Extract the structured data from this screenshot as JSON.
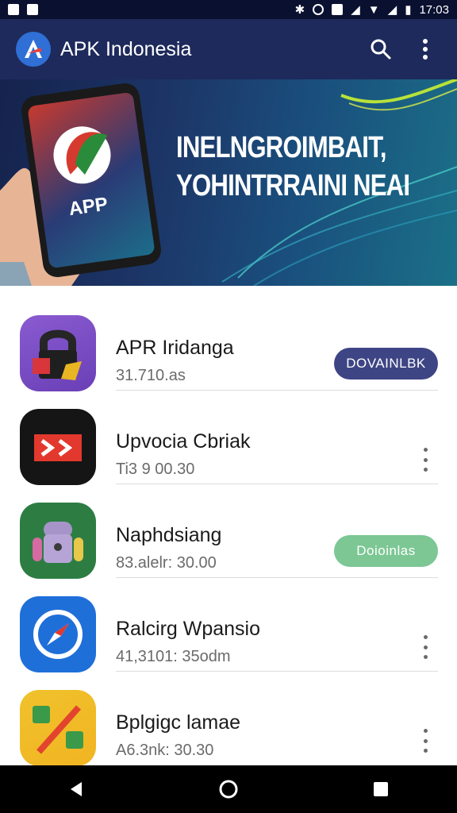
{
  "status_bar": {
    "time": "17:03"
  },
  "app_bar": {
    "title": "APK Indonesia",
    "logo_icon": "apk-logo-icon",
    "search_icon": "search-icon",
    "menu_icon": "more-vertical-icon"
  },
  "banner": {
    "line1": "INELNGROIMBAIT,",
    "line2": "YOHINTRRAINI NEAI",
    "phone_text": "APP"
  },
  "apps": [
    {
      "name": "APR Iridanga",
      "meta": "31.710.as",
      "action": "DOVAINLBK",
      "action_color": "#3e4585",
      "icon": "lock-app-icon"
    },
    {
      "name": "Upvocia Cbriak",
      "meta": "Ti3 9 00.30",
      "icon": "media-app-icon"
    },
    {
      "name": "Naphdsiang",
      "meta": "83.alelr: 30.00",
      "action": "Doioinlas",
      "action_color": "#7cc794",
      "icon": "android-app-icon"
    },
    {
      "name": "Ralcirg Wpansio",
      "meta": "41,3101: 35odm",
      "icon": "compass-app-icon"
    },
    {
      "name": "Bplgigc lamae",
      "meta": "A6.3nk: 30.30",
      "icon": "calculator-app-icon"
    }
  ]
}
